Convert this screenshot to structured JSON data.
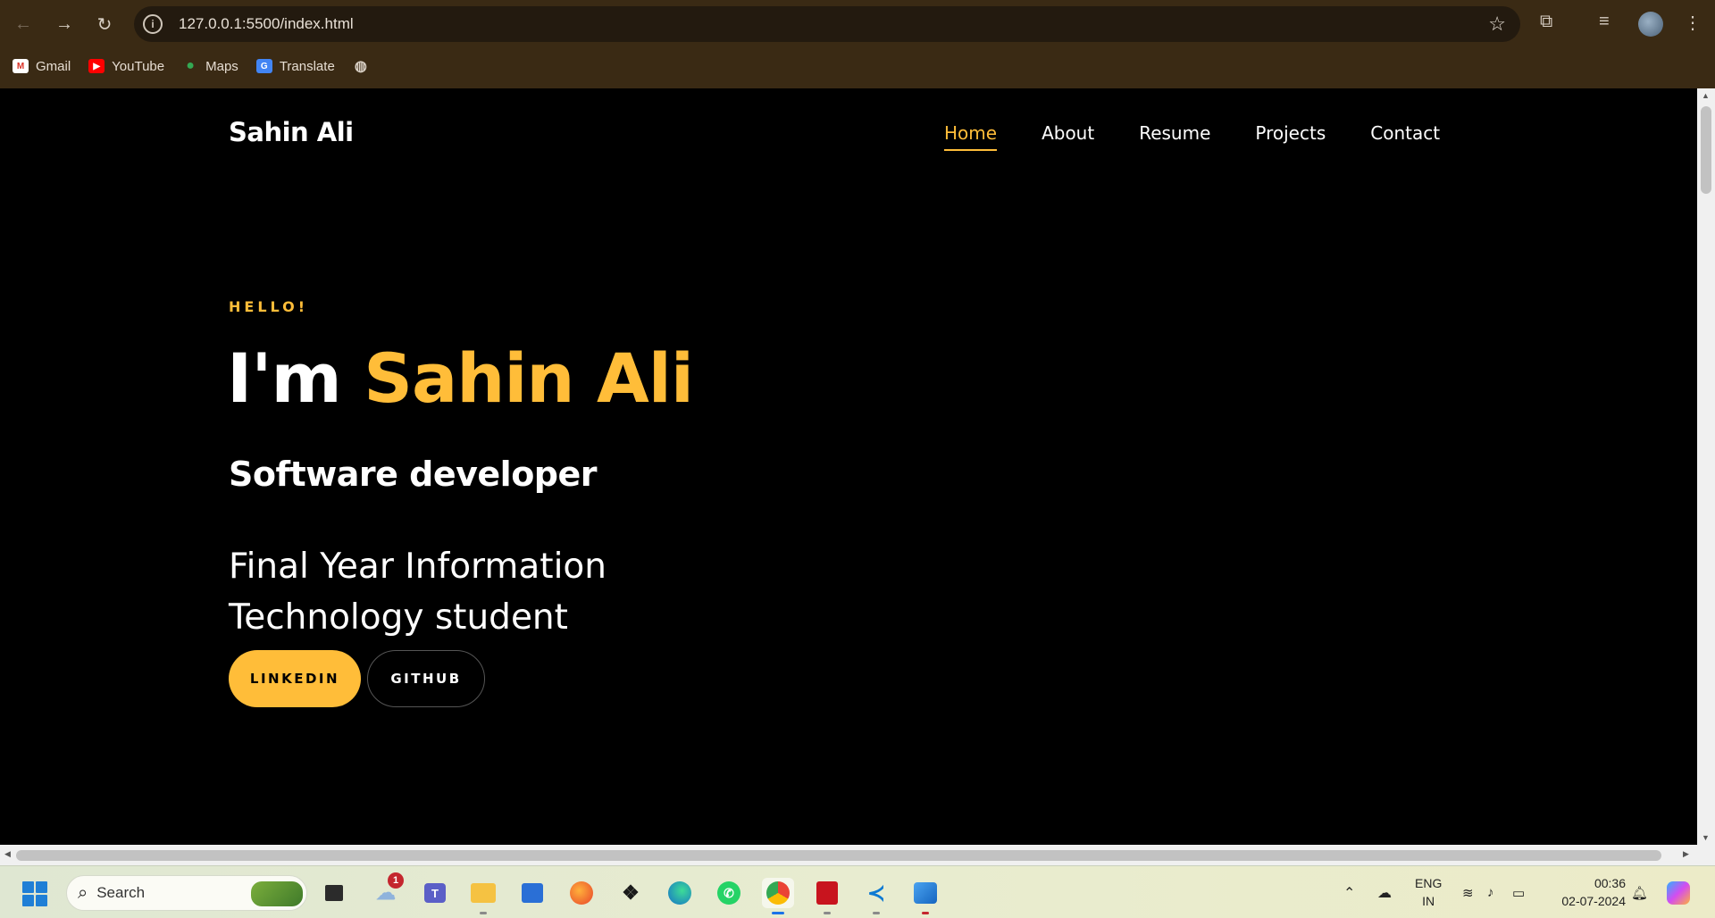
{
  "browser": {
    "url": "127.0.0.1:5500/index.html",
    "bookmarks": [
      {
        "label": "Gmail",
        "icon": "gmail-icon",
        "color": "#d93025"
      },
      {
        "label": "YouTube",
        "icon": "youtube-icon",
        "color": "#ff0000"
      },
      {
        "label": "Maps",
        "icon": "maps-icon",
        "color": "#34a853"
      },
      {
        "label": "Translate",
        "icon": "translate-icon",
        "color": "#4285f4"
      }
    ]
  },
  "site": {
    "brand": "Sahin Ali",
    "nav": [
      {
        "label": "Home",
        "active": true
      },
      {
        "label": "About",
        "active": false
      },
      {
        "label": "Resume",
        "active": false
      },
      {
        "label": "Projects",
        "active": false
      },
      {
        "label": "Contact",
        "active": false
      }
    ],
    "hero": {
      "greeting": "HELLO!",
      "intro_prefix": "I'm ",
      "name": "Sahin Ali",
      "role": "Software developer",
      "description": "Final Year Information Technology student",
      "buttons": {
        "linkedin": "LINKEDIN",
        "github": "GITHUB"
      }
    },
    "accent_color": "#ffbd39"
  },
  "taskbar": {
    "search_label": "Search",
    "weather_badge": "1",
    "language": {
      "line1": "ENG",
      "line2": "IN"
    },
    "time": "00:36",
    "date": "02-07-2024"
  }
}
